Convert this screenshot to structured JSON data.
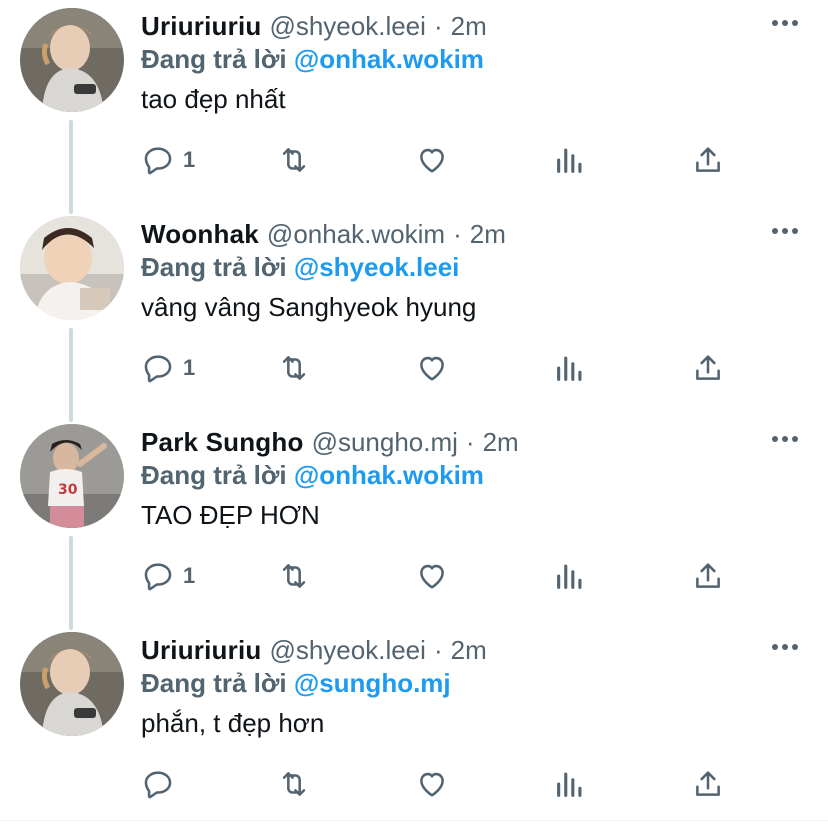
{
  "replies": [
    {
      "display_name": "Uriuriuriu",
      "handle": "@shyeok.leei",
      "separator": "·",
      "time": "2m",
      "reply_prefix": "Đang trả lời",
      "reply_to": "@onhak.wokim",
      "text": "tao đẹp nhất",
      "reply_count": "1",
      "avatar": "photo-light-hoodie"
    },
    {
      "display_name": "Woonhak",
      "handle": "@onhak.wokim",
      "separator": "·",
      "time": "2m",
      "reply_prefix": "Đang trả lời",
      "reply_to": "@shyeok.leei",
      "text": "vâng vâng Sanghyeok hyung",
      "reply_count": "1",
      "avatar": "photo-child"
    },
    {
      "display_name": "Park Sungho",
      "handle": "@sungho.mj",
      "separator": "·",
      "time": "2m",
      "reply_prefix": "Đang trả lời",
      "reply_to": "@onhak.wokim",
      "text": "TAO ĐẸP HƠN",
      "reply_count": "1",
      "avatar": "photo-street"
    },
    {
      "display_name": "Uriuriuriu",
      "handle": "@shyeok.leei",
      "separator": "·",
      "time": "2m",
      "reply_prefix": "Đang trả lời",
      "reply_to": "@sungho.mj",
      "text": "phắn, t đẹp hơn",
      "reply_count": "",
      "avatar": "photo-light-hoodie"
    }
  ],
  "icons": {
    "more": "more-horizontal-icon",
    "reply": "reply-icon",
    "retweet": "retweet-icon",
    "like": "heart-icon",
    "views": "analytics-icon",
    "share": "share-icon"
  },
  "colors": {
    "text": "#0f1419",
    "secondary": "#536471",
    "link": "#1d9bf0",
    "thread_line": "#cfd9de",
    "background": "#ffffff"
  }
}
